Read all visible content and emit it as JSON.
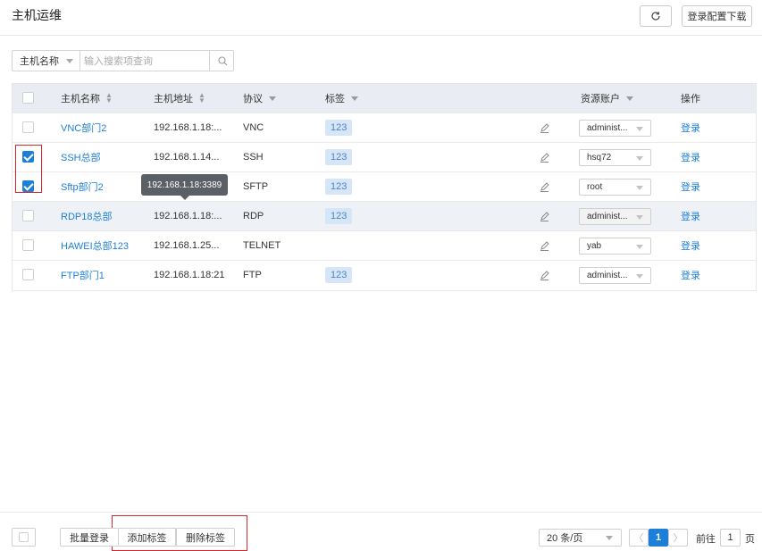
{
  "header": {
    "title": "主机运维",
    "refresh_icon": "refresh-icon",
    "download_label": "登录配置下载"
  },
  "search": {
    "field_label": "主机名称",
    "placeholder": "输入搜索项查询",
    "icon": "search-icon"
  },
  "table": {
    "columns": {
      "name": "主机名称",
      "address": "主机地址",
      "protocol": "协议",
      "tag": "标签",
      "account": "资源账户",
      "action": "操作"
    },
    "rows": [
      {
        "name": "VNC部门2",
        "address": "192.168.1.18:...",
        "protocol": "VNC",
        "tag": "123",
        "account": "administ...",
        "action": "登录",
        "checked": false
      },
      {
        "name": "SSH总部",
        "address": "192.168.1.14...",
        "protocol": "SSH",
        "tag": "123",
        "account": "hsq72",
        "action": "登录",
        "checked": true
      },
      {
        "name": "Sftp部门2",
        "address": "192.168.1.18:...",
        "protocol": "SFTP",
        "tag": "123",
        "account": "root",
        "action": "登录",
        "checked": true
      },
      {
        "name": "RDP18总部",
        "address": "192.168.1.18:...",
        "protocol": "RDP",
        "tag": "123",
        "account": "administ...",
        "action": "登录",
        "checked": false
      },
      {
        "name": "HAWEI总部123",
        "address": "192.168.1.25...",
        "protocol": "TELNET",
        "tag": "",
        "account": "yab",
        "action": "登录",
        "checked": false
      },
      {
        "name": "FTP部门1",
        "address": "192.168.1.18:21",
        "protocol": "FTP",
        "tag": "123",
        "account": "administ...",
        "action": "登录",
        "checked": false
      }
    ],
    "tooltip": "192.168.1.18:3389"
  },
  "footer": {
    "batch_login": "批量登录",
    "add_tag": "添加标签",
    "remove_tag": "删除标签",
    "page_size": "20 条/页",
    "current_page": "1",
    "goto_label": "前往",
    "goto_value": "1",
    "page_suffix": "页"
  },
  "colors": {
    "accent": "#1e7fd8",
    "highlight": "#d9262c"
  }
}
